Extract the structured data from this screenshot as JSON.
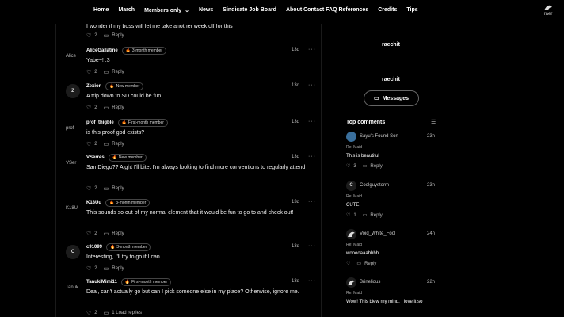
{
  "nav": {
    "links": [
      "Home",
      "March",
      "Members only",
      "News",
      "Sindicate Job Board",
      "About Contact FAQ References",
      "Credits",
      "Tips"
    ],
    "members_chevron": "chevron-down-icon",
    "user_label": "raer"
  },
  "comments": [
    {
      "user": "",
      "badge": "",
      "time": "",
      "body": "I wonder if my boss will let me take another week off for this",
      "likes": "2",
      "reply": "Reply",
      "avatar": ""
    },
    {
      "user": "AliceGallatine",
      "badge": "3-month member",
      "time": "13d",
      "body": "Yabe~! :3",
      "likes": "2",
      "reply": "Reply",
      "avatar": "Alice"
    },
    {
      "user": "Zexion",
      "badge": "New member",
      "time": "13d",
      "body": "A trip down to SD could be fun",
      "likes": "2",
      "reply": "Reply",
      "avatar": "Z"
    },
    {
      "user": "prof_thigble",
      "badge": "First-month member",
      "time": "13d",
      "body": "is this proof god exists?",
      "likes": "2",
      "reply": "Reply",
      "avatar": "prof"
    },
    {
      "user": "VSerres",
      "badge": "New member",
      "time": "13d",
      "body": "San Diego?? Aight I'll bite. I'm always looking to find more conventions to regularly attend",
      "likes": "2",
      "reply": "Reply",
      "avatar": "VSer"
    },
    {
      "user": "K18Uu",
      "badge": "3-month member",
      "time": "13d",
      "body": "This sounds so out of my normal element that it would be fun to go to and check out!",
      "likes": "2",
      "reply": "Reply",
      "avatar": "K18U"
    },
    {
      "user": "c91099",
      "badge": "3-month member",
      "time": "13d",
      "body": "Interesting, I'll try to go if I can",
      "likes": "2",
      "reply": "Reply",
      "avatar": "C"
    },
    {
      "user": "TanukiMimi11",
      "badge": "First-month member",
      "time": "13d",
      "body": "Deal, can't actually go but can I pick someone else in my place? Otherwise, ignore me.",
      "likes": "2",
      "reply": "1 Load replies",
      "avatar": "Tanuk"
    }
  ],
  "sidebar": {
    "name_top": "raechit",
    "name_bottom": "raechit",
    "messages_label": "Messages",
    "top_comments_title": "Top comments",
    "top_comments": [
      {
        "user": "Sayu's Found Son",
        "time": "23h",
        "re": "Re: Maid",
        "text": "This is beautiful",
        "likes": "3",
        "reply": "Reply",
        "avatar": ""
      },
      {
        "user": "Coolguystorm",
        "time": "23h",
        "re": "Re: Maid",
        "text": "CUTE",
        "likes": "1",
        "reply": "Reply",
        "avatar": "C"
      },
      {
        "user": "Void_White_Fool",
        "time": "24h",
        "re": "Re: Maid",
        "text": "wooooaaahhhh",
        "likes": "",
        "reply": "Reply",
        "avatar": ""
      },
      {
        "user": "Brinelious",
        "time": "22h",
        "re": "Re: Maid",
        "text": "Wow! This blew my mind. I love it so",
        "likes": "",
        "reply": "",
        "avatar": "B"
      }
    ]
  },
  "colors": {
    "background": "#000000",
    "badge_flame": "#e87c2a",
    "text": "#f2f2f2"
  }
}
